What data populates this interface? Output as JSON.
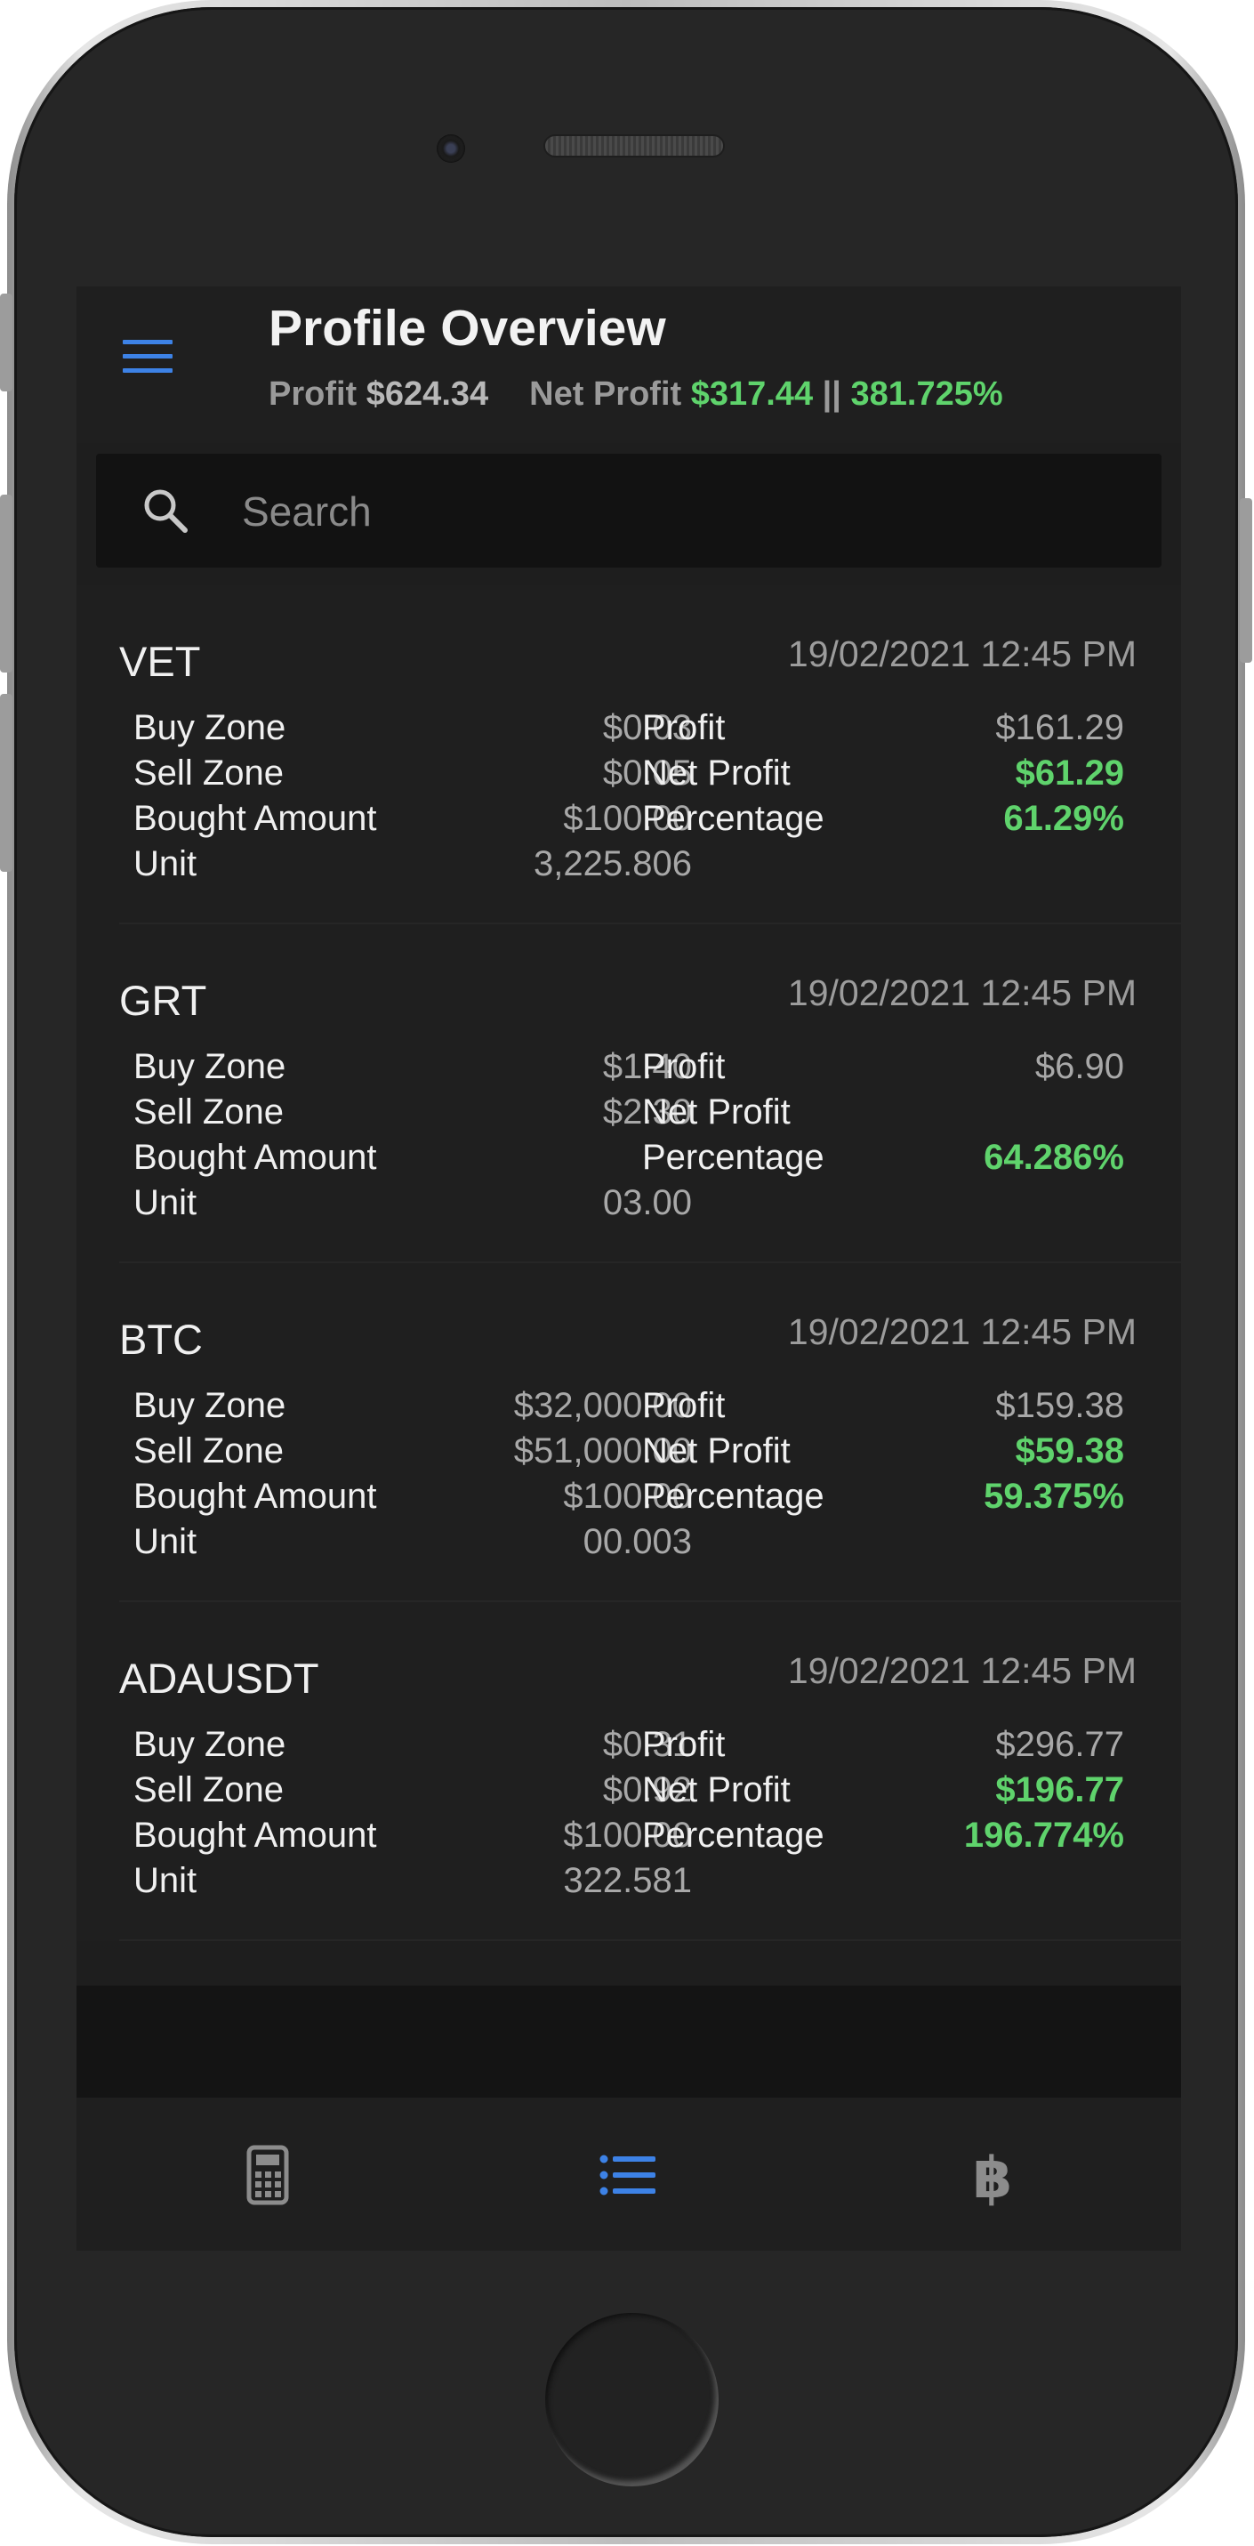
{
  "header": {
    "title": "Profile Overview",
    "profit_label": "Profit",
    "profit_value": "$624.34",
    "net_profit_label": "Net Profit",
    "net_profit_value": "$317.44",
    "separator": "||",
    "net_percentage": "381.725%"
  },
  "search": {
    "placeholder": "Search"
  },
  "labels": {
    "buy_zone": "Buy Zone",
    "sell_zone": "Sell Zone",
    "bought_amount": "Bought Amount",
    "unit": "Unit",
    "profit": "Profit",
    "net_profit": "Net Profit",
    "percentage": "Percentage"
  },
  "cards": [
    {
      "name": "VET",
      "date": "19/02/2021 12:45 PM",
      "buy_zone": "$0.03",
      "sell_zone": "$0.05",
      "bought_amount": "$100.00",
      "unit": "3,225.806",
      "profit": "$161.29",
      "net_profit": "$61.29",
      "percentage": "61.29%"
    },
    {
      "name": "GRT",
      "date": "19/02/2021 12:45 PM",
      "buy_zone": "$1.40",
      "sell_zone": "$2.30",
      "bought_amount": "",
      "unit": "03.00",
      "profit": "$6.90",
      "net_profit": "",
      "percentage": "64.286%"
    },
    {
      "name": "BTC",
      "date": "19/02/2021 12:45 PM",
      "buy_zone": "$32,000.00",
      "sell_zone": "$51,000.00",
      "bought_amount": "$100.00",
      "unit": "00.003",
      "profit": "$159.38",
      "net_profit": "$59.38",
      "percentage": "59.375%"
    },
    {
      "name": "ADAUSDT",
      "date": "19/02/2021 12:45 PM",
      "buy_zone": "$0.31",
      "sell_zone": "$0.92",
      "bought_amount": "$100.00",
      "unit": "322.581",
      "profit": "$296.77",
      "net_profit": "$196.77",
      "percentage": "196.774%"
    }
  ],
  "bottom_nav": {
    "items": [
      {
        "icon": "calculator-icon",
        "active": false
      },
      {
        "icon": "list-icon",
        "active": true
      },
      {
        "icon": "bitcoin-icon",
        "active": false
      }
    ]
  },
  "colors": {
    "accent": "#3d82e6",
    "positive": "#5fd36c",
    "background": "#1e1e1e",
    "inactive_icon": "#8c8c8c"
  }
}
